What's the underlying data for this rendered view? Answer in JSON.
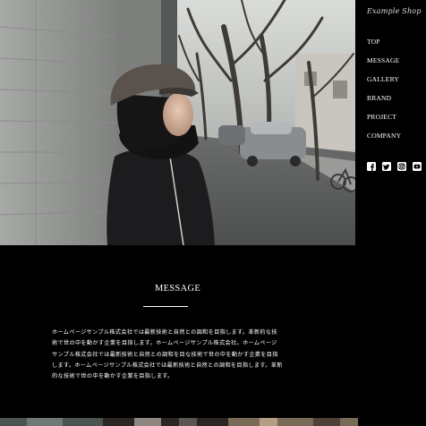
{
  "site": {
    "logo_text": "Example Shop"
  },
  "nav": {
    "items": [
      "TOP",
      "MESSAGE",
      "GALLERY",
      "BRAND",
      "PROJECT",
      "COMPANY"
    ]
  },
  "social": {
    "icons": [
      "facebook-icon",
      "twitter-icon",
      "instagram-icon",
      "youtube-icon"
    ]
  },
  "hero": {
    "image": "photo of a woman in a flat cap and dark coat leaning against a brick wall on a tree-lined street"
  },
  "message": {
    "title": "MESSAGE",
    "body": "ホームページサンプル株式会社では最新技術と自然との調和を目指します。革新的な技術で世の中を動かす企業を目指します。ホームページサンプル株式会社。ホームページサンプル株式会社では最新技術と自然との調和を目な技術で世の中を動かす企業を目指します。ホームページサンプル株式会社では最新技術と自然との調和を目指します。革新的な技術で世の中を動かす企業を目指します。"
  },
  "colors": {
    "background": "#000000",
    "text": "#ffffff"
  }
}
